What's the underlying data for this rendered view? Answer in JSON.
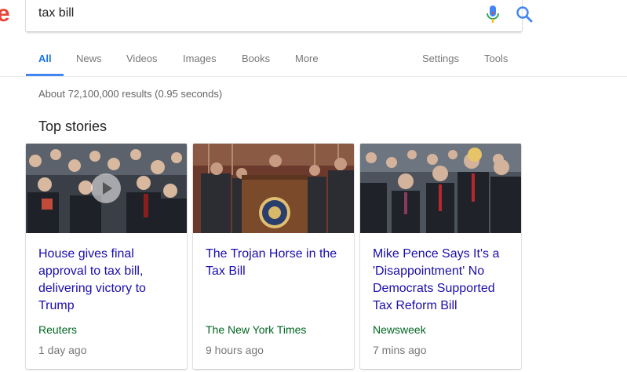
{
  "search": {
    "query": "tax bill"
  },
  "tabs": [
    {
      "label": "All",
      "active": true
    },
    {
      "label": "News"
    },
    {
      "label": "Videos"
    },
    {
      "label": "Images"
    },
    {
      "label": "Books"
    },
    {
      "label": "More"
    }
  ],
  "tools": {
    "settings": "Settings",
    "tools": "Tools"
  },
  "result_stats": "About 72,100,000 results (0.95 seconds)",
  "top_stories": {
    "title": "Top stories",
    "cards": [
      {
        "headline": "House gives final approval to tax bill, delivering victory to Trump",
        "source": "Reuters",
        "time": "1 day ago",
        "has_video": true
      },
      {
        "headline": "The Trojan Horse in the Tax Bill",
        "source": "The New York Times",
        "time": "9 hours ago"
      },
      {
        "headline": "Mike Pence Says It's a 'Disappointment' No Democrats Supported Tax Reform Bill",
        "source": "Newsweek",
        "time": "7 mins ago"
      }
    ]
  },
  "colors": {
    "link": "#1a0dab",
    "source": "#006621",
    "accent": "#4285f4"
  },
  "icons": [
    "mic-icon",
    "search-icon",
    "play-icon"
  ]
}
